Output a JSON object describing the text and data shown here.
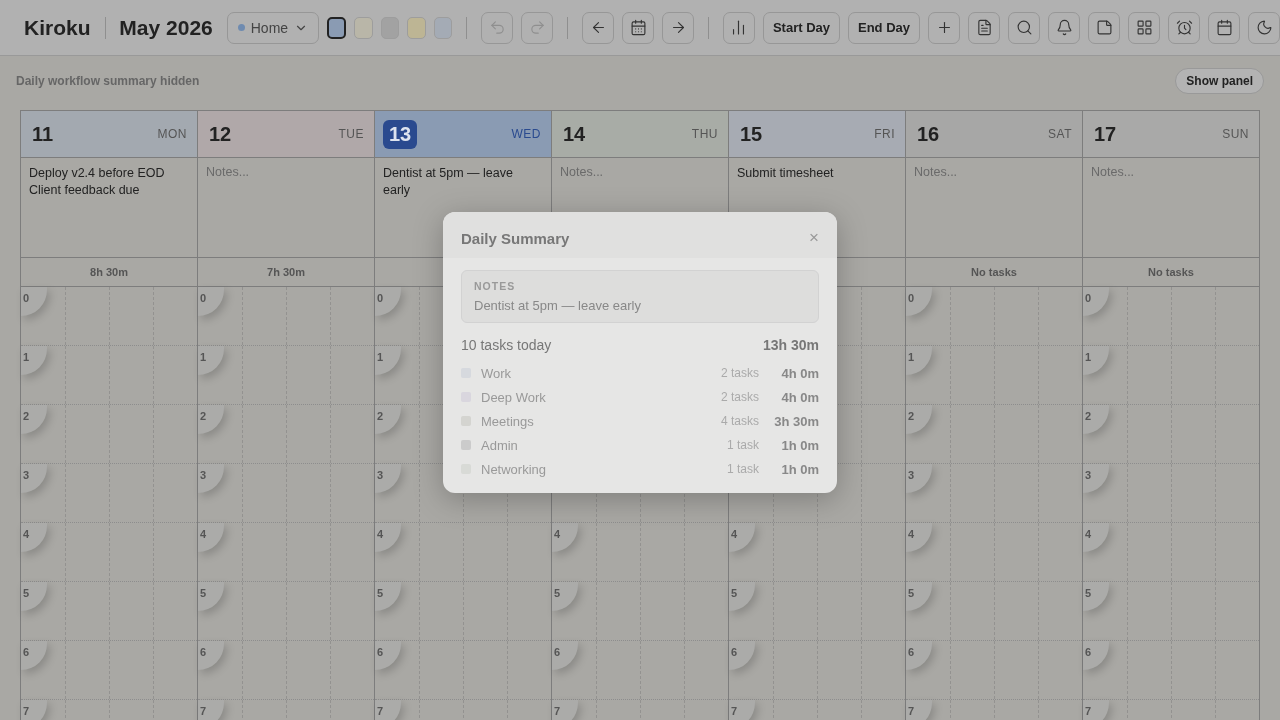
{
  "app": {
    "name": "Kiroku",
    "period": "May 2026"
  },
  "profile": {
    "label": "Home",
    "color": "#6f8bb0"
  },
  "swatches": [
    {
      "color": "#8a9bb3",
      "selected": true
    },
    {
      "color": "#b9b6a8",
      "selected": false
    },
    {
      "color": "#a2a2a2",
      "selected": false
    },
    {
      "color": "#bdb594",
      "selected": false
    },
    {
      "color": "#a4abb5",
      "selected": false
    }
  ],
  "history": {
    "undo_disabled": true,
    "redo_disabled": true
  },
  "buttons": [
    "Start Day",
    "End Day"
  ],
  "banner": {
    "text": "Daily workflow summary hidden",
    "button": "Show panel"
  },
  "days": [
    {
      "date": "11",
      "weekday": "MON",
      "color": "#a3a9b0",
      "today": false,
      "notes": [
        "Deploy v2.4 before EOD",
        "Client feedback due"
      ],
      "total": "8h 30m",
      "hours": [
        "0",
        "1",
        "2",
        "3",
        "4",
        "5",
        "6",
        "7"
      ]
    },
    {
      "date": "12",
      "weekday": "TUE",
      "color": "#b0a8a9",
      "today": false,
      "placeholder": "Notes...",
      "total": "7h 30m",
      "hours": [
        "0",
        "1",
        "2",
        "3",
        "4",
        "5",
        "6",
        "7"
      ]
    },
    {
      "date": "13",
      "weekday": "WED",
      "color": "#8a9bb3",
      "today": true,
      "notes": [
        "Dentist at 5pm — leave early"
      ],
      "hours": [
        "0",
        "1",
        "2",
        "3",
        "4",
        "5",
        "6",
        "7"
      ]
    },
    {
      "date": "14",
      "weekday": "THU",
      "color": "#a8aca6",
      "today": false,
      "placeholder": "Notes...",
      "hours": [
        "4",
        "5",
        "6",
        "7"
      ]
    },
    {
      "date": "15",
      "weekday": "FRI",
      "color": "#a7abb3",
      "today": false,
      "notes": [
        "Submit timesheet"
      ],
      "hours": [
        "4",
        "5",
        "6",
        "7"
      ]
    },
    {
      "date": "16",
      "weekday": "SAT",
      "color": "#a7a7a6",
      "today": false,
      "placeholder": "Notes...",
      "total": "No tasks",
      "hours": [
        "0",
        "1",
        "2",
        "3",
        "4",
        "5",
        "6",
        "7"
      ]
    },
    {
      "date": "17",
      "weekday": "SUN",
      "color": "#a9a9a8",
      "today": false,
      "placeholder": "Notes...",
      "total": "No tasks",
      "hours": [
        "0",
        "1",
        "2",
        "3",
        "4",
        "5",
        "6",
        "7"
      ]
    }
  ],
  "dialog": {
    "title": "Daily Summary",
    "close": "×",
    "notes_label": "NOTES",
    "notes": "Dentist at 5pm — leave early",
    "count": "10 tasks today",
    "total": "13h 30m",
    "categories": [
      {
        "name": "Work",
        "tasks": "2 tasks",
        "time": "4h 0m",
        "color": "#d6d9de"
      },
      {
        "name": "Deep Work",
        "tasks": "2 tasks",
        "time": "4h 0m",
        "color": "#d9d6de"
      },
      {
        "name": "Meetings",
        "tasks": "4 tasks",
        "time": "3h 30m",
        "color": "#d4d4d0"
      },
      {
        "name": "Admin",
        "tasks": "1 task",
        "time": "1h 0m",
        "color": "#cbcbcb"
      },
      {
        "name": "Networking",
        "tasks": "1 task",
        "time": "1h 0m",
        "color": "#d8dad6"
      }
    ]
  }
}
